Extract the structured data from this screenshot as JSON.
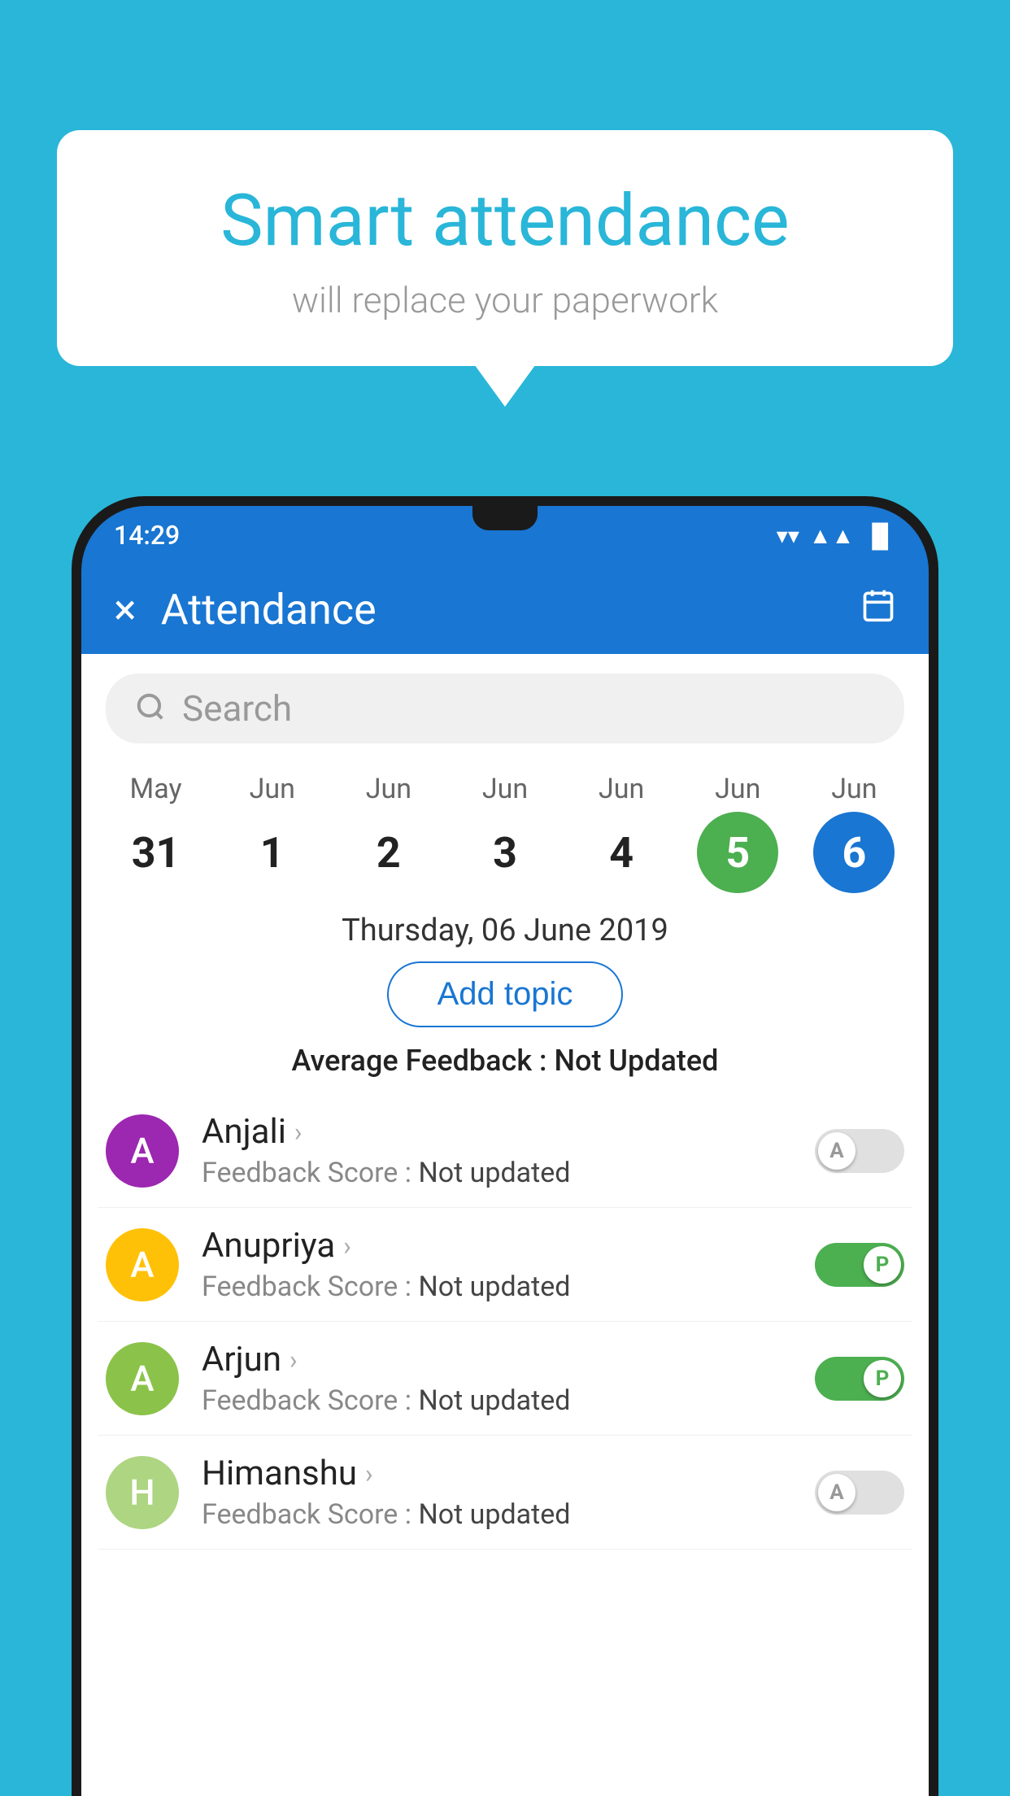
{
  "background_color": "#29b6d8",
  "speech_bubble": {
    "title": "Smart attendance",
    "subtitle": "will replace your paperwork"
  },
  "status_bar": {
    "time": "14:29",
    "icons": [
      "wifi",
      "signal",
      "battery"
    ]
  },
  "app_bar": {
    "title": "Attendance",
    "close_label": "×",
    "calendar_icon": "📅"
  },
  "search": {
    "placeholder": "Search"
  },
  "calendar": {
    "days": [
      {
        "month": "May",
        "date": "31",
        "state": "normal"
      },
      {
        "month": "Jun",
        "date": "1",
        "state": "normal"
      },
      {
        "month": "Jun",
        "date": "2",
        "state": "normal"
      },
      {
        "month": "Jun",
        "date": "3",
        "state": "normal"
      },
      {
        "month": "Jun",
        "date": "4",
        "state": "normal"
      },
      {
        "month": "Jun",
        "date": "5",
        "state": "today"
      },
      {
        "month": "Jun",
        "date": "6",
        "state": "selected"
      }
    ]
  },
  "selected_date_label": "Thursday, 06 June 2019",
  "add_topic_label": "Add topic",
  "avg_feedback_label": "Average Feedback : ",
  "avg_feedback_value": "Not Updated",
  "students": [
    {
      "name": "Anjali",
      "avatar_letter": "A",
      "avatar_color": "#9c27b0",
      "feedback_label": "Feedback Score : ",
      "feedback_value": "Not updated",
      "toggle": "off",
      "toggle_letter": "A"
    },
    {
      "name": "Anupriya",
      "avatar_letter": "A",
      "avatar_color": "#ffc107",
      "feedback_label": "Feedback Score : ",
      "feedback_value": "Not updated",
      "toggle": "on",
      "toggle_letter": "P"
    },
    {
      "name": "Arjun",
      "avatar_letter": "A",
      "avatar_color": "#8bc34a",
      "feedback_label": "Feedback Score : ",
      "feedback_value": "Not updated",
      "toggle": "on",
      "toggle_letter": "P"
    },
    {
      "name": "Himanshu",
      "avatar_letter": "H",
      "avatar_color": "#aed581",
      "feedback_label": "Feedback Score : ",
      "feedback_value": "Not updated",
      "toggle": "off",
      "toggle_letter": "A"
    }
  ]
}
